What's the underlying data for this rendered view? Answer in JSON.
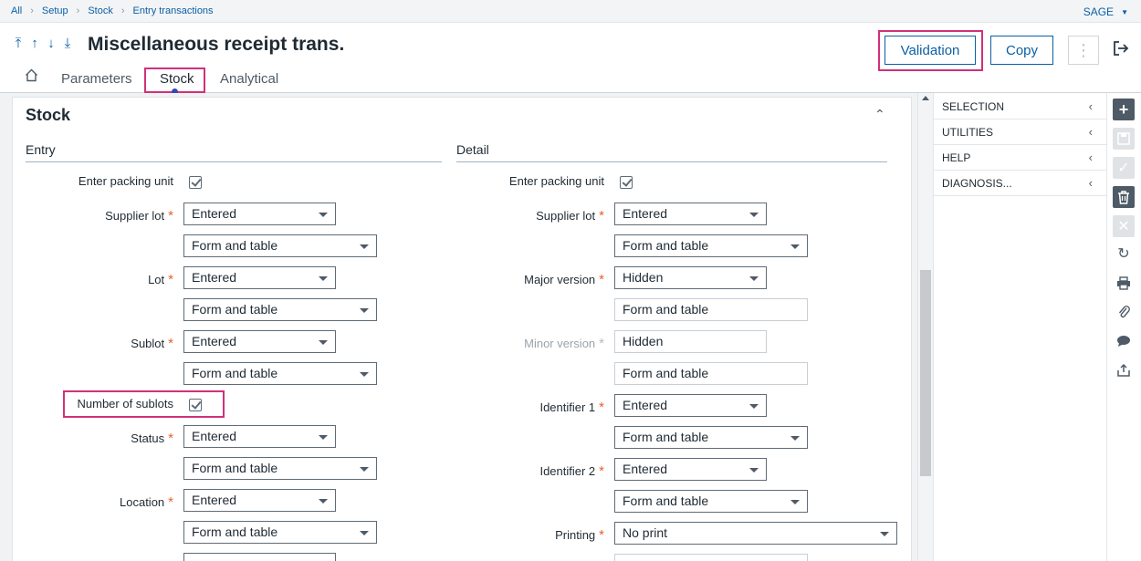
{
  "breadcrumb": [
    "All",
    "Setup",
    "Stock",
    "Entry transactions"
  ],
  "top_menu": {
    "user_label": "SAGE"
  },
  "header": {
    "title": "Miscellaneous receipt trans.",
    "validation_label": "Validation",
    "copy_label": "Copy",
    "more_label": "⋮"
  },
  "tabs": [
    {
      "label": "Parameters"
    },
    {
      "label": "Stock",
      "active": true
    },
    {
      "label": "Analytical"
    }
  ],
  "section": {
    "title": "Stock"
  },
  "entry": {
    "title": "Entry",
    "packing_unit": {
      "label": "Enter packing unit",
      "checked": true
    },
    "supplier_lot": {
      "label": "Supplier lot",
      "value": "Entered",
      "display": "Form and table"
    },
    "lot": {
      "label": "Lot",
      "value": "Entered",
      "display": "Form and table"
    },
    "sublot": {
      "label": "Sublot",
      "value": "Entered",
      "display": "Form and table"
    },
    "number_of_sublots": {
      "label": "Number of sublots",
      "checked": true
    },
    "status": {
      "label": "Status",
      "value": "Entered",
      "display": "Form and table"
    },
    "location": {
      "label": "Location",
      "value": "Entered",
      "display": "Form and table"
    }
  },
  "detail": {
    "title": "Detail",
    "packing_unit": {
      "label": "Enter packing unit",
      "checked": true
    },
    "supplier_lot": {
      "label": "Supplier lot",
      "value": "Entered",
      "display": "Form and table"
    },
    "major_version": {
      "label": "Major version",
      "value": "Hidden",
      "display": "Form and table"
    },
    "minor_version": {
      "label": "Minor version",
      "value": "Hidden",
      "display": "Form and table"
    },
    "identifier1": {
      "label": "Identifier 1",
      "value": "Entered",
      "display": "Form and table"
    },
    "identifier2": {
      "label": "Identifier 2",
      "value": "Entered",
      "display": "Form and table"
    },
    "printing": {
      "label": "Printing",
      "value": "No print"
    }
  },
  "side_panel": [
    "SELECTION",
    "UTILITIES",
    "HELP",
    "DIAGNOSIS..."
  ],
  "toolbar_icons": [
    "plus-icon",
    "save-icon",
    "check-icon",
    "trash-icon",
    "close-icon",
    "refresh-icon",
    "print-icon",
    "paperclip-icon",
    "comment-icon",
    "share-icon"
  ],
  "colors": {
    "accent": "#0b5fa5",
    "highlight": "#d0317a",
    "required": "#e8622c"
  }
}
